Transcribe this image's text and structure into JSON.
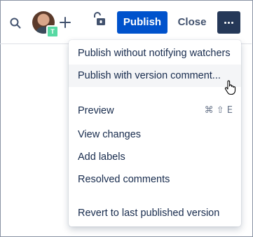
{
  "toolbar": {
    "avatar_badge": "T",
    "publish_label": "Publish",
    "close_label": "Close"
  },
  "menu": {
    "items": [
      {
        "label": "Publish without notifying watchers"
      },
      {
        "label": "Publish with version comment..."
      },
      {
        "label": "Preview",
        "shortcut": "⌘ ⇧ E"
      },
      {
        "label": "View changes"
      },
      {
        "label": "Add labels"
      },
      {
        "label": "Resolved comments"
      },
      {
        "label": "Revert to last published version"
      }
    ]
  },
  "colors": {
    "primary": "#0052cc",
    "more_button": "#253858",
    "text": "#172b4d",
    "hover": "#f4f5f7",
    "badge": "#57d9a3"
  },
  "icons": [
    "search-icon",
    "avatar",
    "add-icon",
    "unlock-icon",
    "more-icon",
    "pointer-cursor-icon"
  ]
}
